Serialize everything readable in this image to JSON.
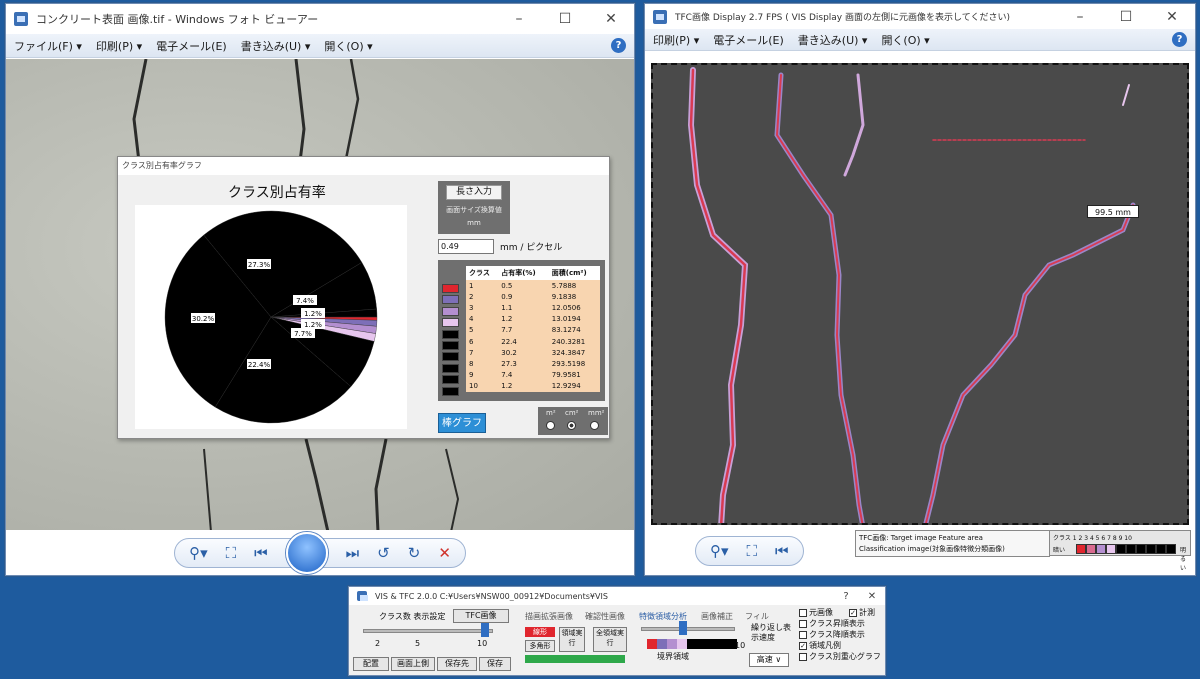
{
  "photo_window": {
    "title": "コンクリート表面 画像.tif - Windows フォト ビューアー",
    "menu": [
      "ファイル(F) ▾",
      "印刷(P) ▾",
      "電子メール(E)",
      "書き込み(U) ▾",
      "開く(O) ▾"
    ],
    "controls": [
      "–",
      "☐",
      "✕"
    ],
    "help": "?"
  },
  "chart_dialog": {
    "window_title": "クラス別占有率グラフ",
    "length_button": "長さ入力",
    "length_caption1": "画面サイズ換算値",
    "length_caption2": "mm",
    "mm_value": "0.49",
    "mm_unit": "mm / ピクセル",
    "table_headers": [
      "クラス",
      "占有率(%)",
      "面積(cm²)"
    ],
    "bar_graph_button": "棒グラフ",
    "units": [
      "m²",
      "cm²",
      "mm²"
    ]
  },
  "chart_data": {
    "type": "pie",
    "title": "クラス別占有率",
    "categories": [
      "1",
      "2",
      "3",
      "4",
      "5",
      "6",
      "7",
      "8",
      "9",
      "10"
    ],
    "values": [
      0.5,
      0.9,
      1.1,
      1.2,
      7.7,
      22.4,
      30.2,
      27.3,
      7.4,
      1.2
    ],
    "areas_cm2": [
      "5.7888",
      "9.1838",
      "12.0506",
      "13.0194",
      "83.1274",
      "240.3281",
      "324.3847",
      "293.5198",
      "79.9581",
      "12.9294"
    ],
    "colors": [
      "#e0262e",
      "#7d6fb8",
      "#b48fd0",
      "#e7c6ee",
      "#000000",
      "#000000",
      "#000000",
      "#000000",
      "#000000",
      "#000000"
    ],
    "slice_labels": [
      "27.3%",
      "7.4%",
      "1.2%",
      "1.2%",
      "7.7%",
      "22.4%",
      "30.2%"
    ]
  },
  "tfc_window": {
    "title": "TFC画像 Display 2.7 FPS ( VIS Display 画面の左側に元画像を表示してください)",
    "menu": [
      "印刷(P) ▾",
      "電子メール(E)",
      "書き込み(U) ▾",
      "開く(O) ▾"
    ],
    "controls": [
      "–",
      "☐",
      "✕"
    ],
    "measurement": "99.5 mm",
    "tooltip_line1": "TFC画像: Target image Feature area",
    "tooltip_line2": "Classification image(対象画像特徴分類画像)",
    "legend_label": "クラス 1 2 3 4 5 6 7 8 9 10",
    "legend_dark": "暗い",
    "legend_light": "明るい",
    "legend_colors": [
      "#e0262e",
      "#d96a8f",
      "#b48fd0",
      "#e7c6ee",
      "#000000",
      "#000000",
      "#000000",
      "#000000",
      "#000000",
      "#000000"
    ]
  },
  "vis_panel": {
    "title": "VIS & TFC 2.0.0   C:¥Users¥NSW00_00912¥Documents¥VIS",
    "controls": [
      "?",
      "✕"
    ],
    "class_label": "クラス数 表示設定",
    "tfc_button": "TFC画像",
    "slider_min": "2",
    "slider_mid": "5",
    "slider_max": "10",
    "buttons_bottom": [
      "配置",
      "画面上側",
      "保存先",
      "保存"
    ],
    "tabs": [
      "描画拡張画像",
      "確認性画像",
      "特徴領域分析",
      "画像補正",
      "フィル"
    ],
    "red_button": "線形",
    "polygon_button": "多角形",
    "region_run": "領域実行",
    "all_region_run": "全領域実行",
    "boundary_label": "境界領域",
    "right_slider_max": "10",
    "repeat_label": "繰り返し表示速度",
    "speed_value": "高速 ∨",
    "checkboxes": [
      {
        "label": "元画像",
        "checked": false
      },
      {
        "label": "計測",
        "checked": true
      },
      {
        "label": "クラス昇順表示",
        "checked": false
      },
      {
        "label": "クラス降順表示",
        "checked": false
      },
      {
        "label": "領域凡例",
        "checked": true
      },
      {
        "label": "クラス別重心グラフ",
        "checked": false
      }
    ]
  }
}
